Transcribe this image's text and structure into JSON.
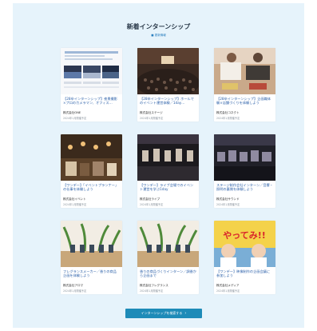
{
  "section": {
    "title": "新着インターンシップ",
    "subtitle": "■ 更新情報"
  },
  "cards": [
    {
      "title": "【28卒インターンシップ】夜景撮影×プロのカメラマン、オフィス…",
      "meta": "株式会社ONE",
      "date": "2024年1月開催予定"
    },
    {
      "title": "【28卒インターンシップ】ホールでのイベント運営体験／1day…",
      "meta": "株式会社ステージ",
      "date": "2024年1月開催予定"
    },
    {
      "title": "【28卒インターンシップ】企画職体験×店舗づくりを体験しよう",
      "meta": "株式会社コネクト",
      "date": "2024年1月開催予定"
    },
    {
      "title": "【ワンデー】「イベントプランナー」の仕事を体験しよう",
      "meta": "株式会社イベント",
      "date": "2024年1月開催予定"
    },
    {
      "title": "【ワンデー】ライブ会場でのイベント運営を学ぶ1day",
      "meta": "株式会社ライブ",
      "date": "2024年1月開催予定"
    },
    {
      "title": "ステージ制作会社インターン／音響・照明の裏側を体験しよう",
      "meta": "株式会社サウンド",
      "date": "2024年1月開催予定"
    },
    {
      "title": "フレグランスメーカー／香りの商品企画を体験しよう",
      "meta": "株式会社アロマ",
      "date": "2024年1月開催予定"
    },
    {
      "title": "香りの商品づくりインターン／調香から企画まで",
      "meta": "株式会社フレグランス",
      "date": "2024年1月開催予定"
    },
    {
      "title": "【ワンデー】映像制作の企画会議に参加しよう",
      "meta": "株式会社メディア",
      "date": "2024年1月開催予定"
    }
  ],
  "thumb9": {
    "text": "やってみ!!"
  },
  "more_button": {
    "label": "インターンシップを検索する",
    "arrow": "›"
  }
}
